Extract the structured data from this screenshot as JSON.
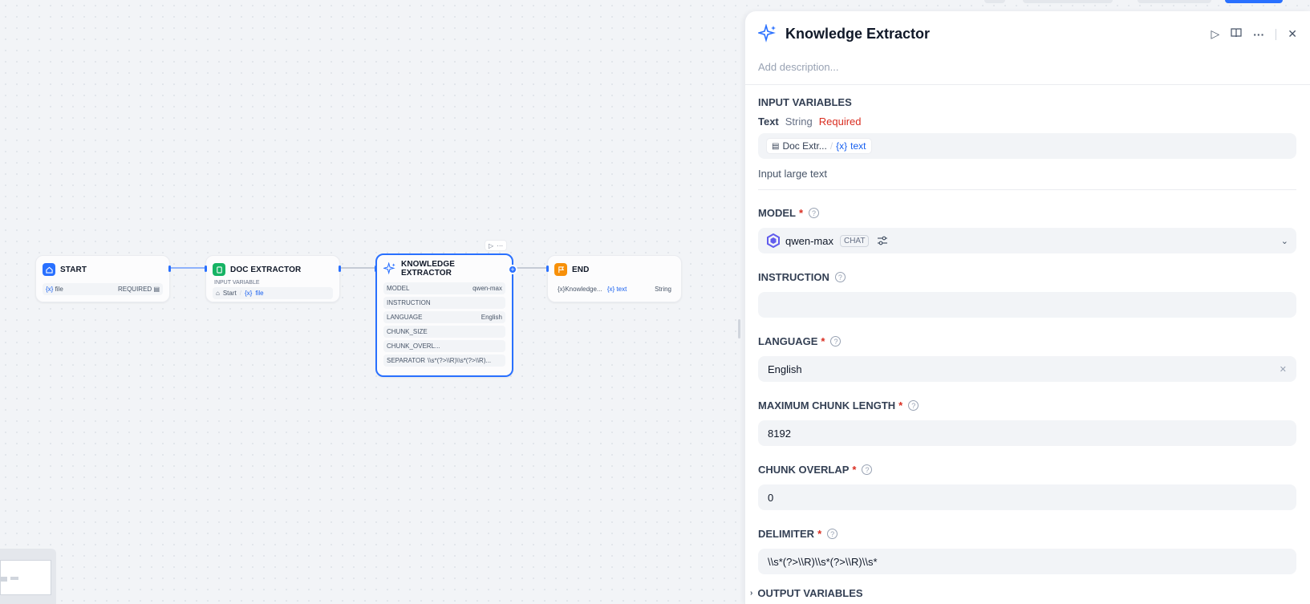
{
  "canvas": {
    "nodes": {
      "start": {
        "title": "START",
        "var_label": "file",
        "var_prefix": "{x}",
        "required": "REQUIRED"
      },
      "doc": {
        "title": "DOC EXTRACTOR",
        "section": "INPUT VARIABLE",
        "src_node": "Start",
        "src_var": "file",
        "var_prefix": "{x}"
      },
      "ke": {
        "title": "KNOWLEDGE EXTRACTOR",
        "rows": [
          {
            "k": "MODEL",
            "v": "qwen-max"
          },
          {
            "k": "INSTRUCTION",
            "v": ""
          },
          {
            "k": "LANGUAGE",
            "v": "English"
          },
          {
            "k": "CHUNK_SIZE",
            "v": ""
          },
          {
            "k": "CHUNK_OVERL...",
            "v": ""
          },
          {
            "k": "SEPARATOR",
            "v": "\\\\s*(?>\\\\R)\\\\s*(?>\\\\R)..."
          }
        ]
      },
      "end": {
        "title": "END",
        "var_prefix": "{x}",
        "src_node": "Knowledge...",
        "src_var": "text",
        "type": "String"
      }
    }
  },
  "panel": {
    "title": "Knowledge Extractor",
    "description_placeholder": "Add description...",
    "input_variables": {
      "label": "INPUT VARIABLES",
      "var_name": "Text",
      "var_type": "String",
      "var_required": "Required",
      "src_node": "Doc Extr...",
      "src_sep": "/",
      "src_var": "text",
      "var_prefix": "{x}",
      "hint": "Input large text"
    },
    "model": {
      "label": "MODEL",
      "name": "qwen-max",
      "tag": "CHAT"
    },
    "instruction": {
      "label": "INSTRUCTION",
      "value": ""
    },
    "language": {
      "label": "LANGUAGE",
      "value": "English"
    },
    "max_chunk": {
      "label": "MAXIMUM CHUNK LENGTH",
      "value": "8192"
    },
    "chunk_overlap": {
      "label": "CHUNK OVERLAP",
      "value": "0"
    },
    "delimiter": {
      "label": "DELIMITER",
      "value": "\\\\s*(?>\\\\R)\\\\s*(?>\\\\R)\\\\s*"
    },
    "output_variables": {
      "label": "OUTPUT VARIABLES"
    },
    "star": "*",
    "help": "?"
  },
  "colors": {
    "accent": "#2970ff",
    "start_icon": "#2970ff",
    "doc_icon": "#16b364",
    "end_icon": "#f79009",
    "required": "#d92d20"
  },
  "icons": {
    "ke": "sparkle-icon",
    "start": "home-icon",
    "doc": "document-icon",
    "end": "flag-icon"
  }
}
